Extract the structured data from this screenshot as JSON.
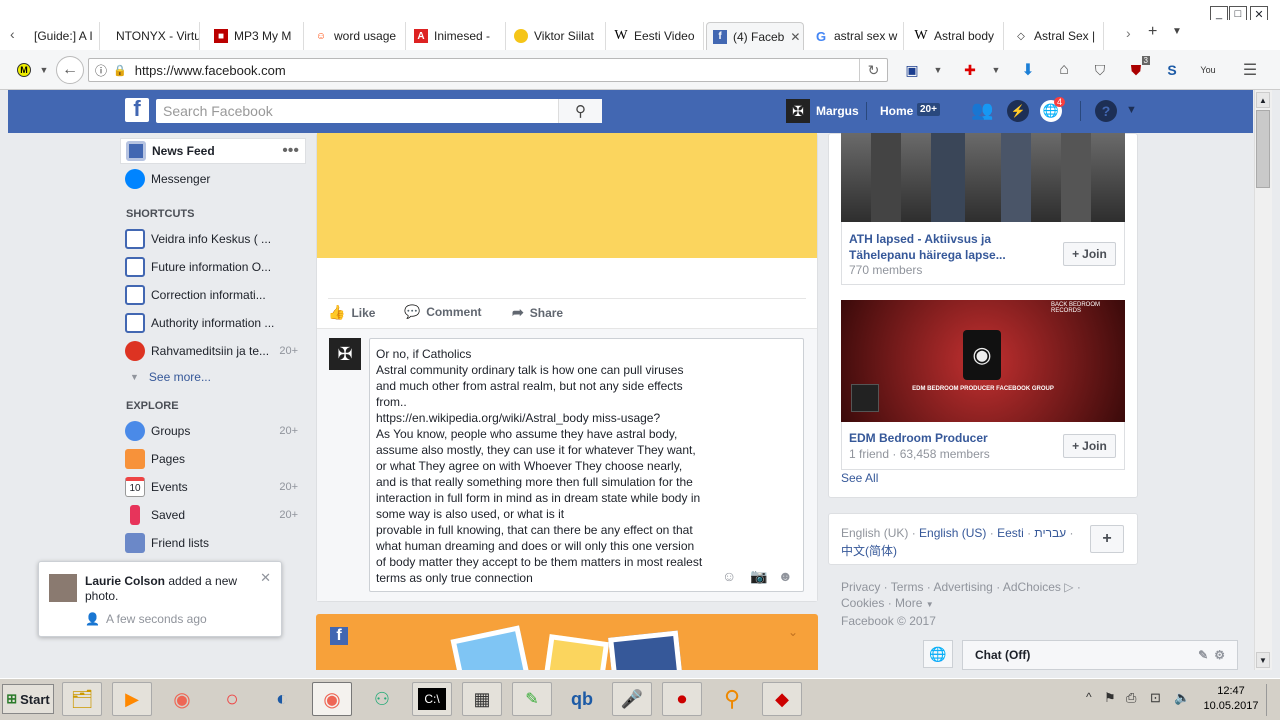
{
  "browser": {
    "tabs": [
      {
        "label": "[Guide:] A I",
        "icon": "doc-icon"
      },
      {
        "label": "NTONYX - Virtu",
        "icon": "none"
      },
      {
        "label": "MP3 My M",
        "icon": "mp3-icon"
      },
      {
        "label": "word usage",
        "icon": "reddit-icon"
      },
      {
        "label": "Inimesed -",
        "icon": "a-icon"
      },
      {
        "label": "Viktor Siilat",
        "icon": "circle-icon"
      },
      {
        "label": "Eesti Video",
        "icon": "wikipedia-icon"
      },
      {
        "label": "(4) Faceb",
        "icon": "facebook-icon"
      },
      {
        "label": "astral sex w",
        "icon": "google-icon"
      },
      {
        "label": "Astral body",
        "icon": "wikipedia-icon"
      },
      {
        "label": "Astral Sex |",
        "icon": "diamond-icon"
      }
    ],
    "url": "https://www.facebook.com",
    "ext_badge": "3"
  },
  "fb": {
    "search_placeholder": "Search Facebook",
    "user_name": "Margus",
    "home_label": "Home",
    "home_count": "20+",
    "notif_count": "4"
  },
  "sidebar": {
    "news_feed": "News Feed",
    "messenger": "Messenger",
    "shortcuts_title": "SHORTCUTS",
    "shortcuts": [
      {
        "label": "Veidra info Keskus ( ...",
        "count": ""
      },
      {
        "label": "Future information O...",
        "count": ""
      },
      {
        "label": "Correction informati...",
        "count": ""
      },
      {
        "label": "Authority information ...",
        "count": ""
      },
      {
        "label": "Rahvameditsiin ja te...",
        "count": "20+"
      }
    ],
    "see_more": "See more...",
    "explore_title": "EXPLORE",
    "explore": [
      {
        "label": "Groups",
        "count": "20+"
      },
      {
        "label": "Pages",
        "count": ""
      },
      {
        "label": "Events",
        "count": "20+",
        "icon_text": "10"
      },
      {
        "label": "Saved",
        "count": "20+"
      },
      {
        "label": "Friend lists",
        "count": ""
      }
    ]
  },
  "post": {
    "like": "Like",
    "comment": "Comment",
    "share": "Share",
    "comment_lines": [
      "Or no, if Catholics",
      "Astral community ordinary talk is how one can pull viruses",
      "and much other from astral realm, but not any  side effects",
      "from..",
      "https://en.wikipedia.org/wiki/Astral_body miss-usage?",
      "As You know, people who assume they have astral body,",
      "assume also mostly, they can use it for whatever They want,",
      "or what They agree on with Whoever They choose nearly,",
      "and is that really something more then full simulation for the",
      "interaction in full form in mind as in dream state while body in",
      "some way is also used, or what is it",
      "provable in full knowing, that can there be any effect on that",
      "what human dreaming and does or will only this one version",
      "of body matter they accept to be them matters in most realest",
      "terms as only true connection"
    ]
  },
  "groups": [
    {
      "name_line1": "ATH lapsed - Aktiivsus ja",
      "name_line2": "Tähelepanu häirega lapse...",
      "meta": "770 members",
      "join": "Join"
    },
    {
      "name_line1": "EDM Bedroom Producer",
      "name_line2": "",
      "meta": "1 friend · 63,458 members",
      "join": "Join",
      "banner_small": "BACK BEDROOM RECORDS",
      "banner_text": "EDM BEDROOM PRODUCER FACEBOOK GROUP"
    }
  ],
  "see_all": "See All",
  "languages": {
    "line1": [
      "English (UK)",
      "English (US)",
      "Eesti",
      "עברית"
    ],
    "line2": "中文(简体)"
  },
  "footer": {
    "links1": [
      "Privacy",
      "Terms",
      "Advertising",
      "AdChoices"
    ],
    "links2": [
      "Cookies",
      "More"
    ],
    "copyright": "Facebook © 2017"
  },
  "chat": {
    "label": "Chat (Off)"
  },
  "notification": {
    "name": "Laurie Colson",
    "text": " added a new photo.",
    "time": "A few seconds ago"
  },
  "taskbar": {
    "start": "Start",
    "time": "12:47",
    "date": "10.05.2017"
  },
  "colors": {
    "fb_blue": "#4267b2",
    "link": "#365899",
    "yellow_post": "#fbd55e",
    "orange_card": "#f7a13a"
  }
}
